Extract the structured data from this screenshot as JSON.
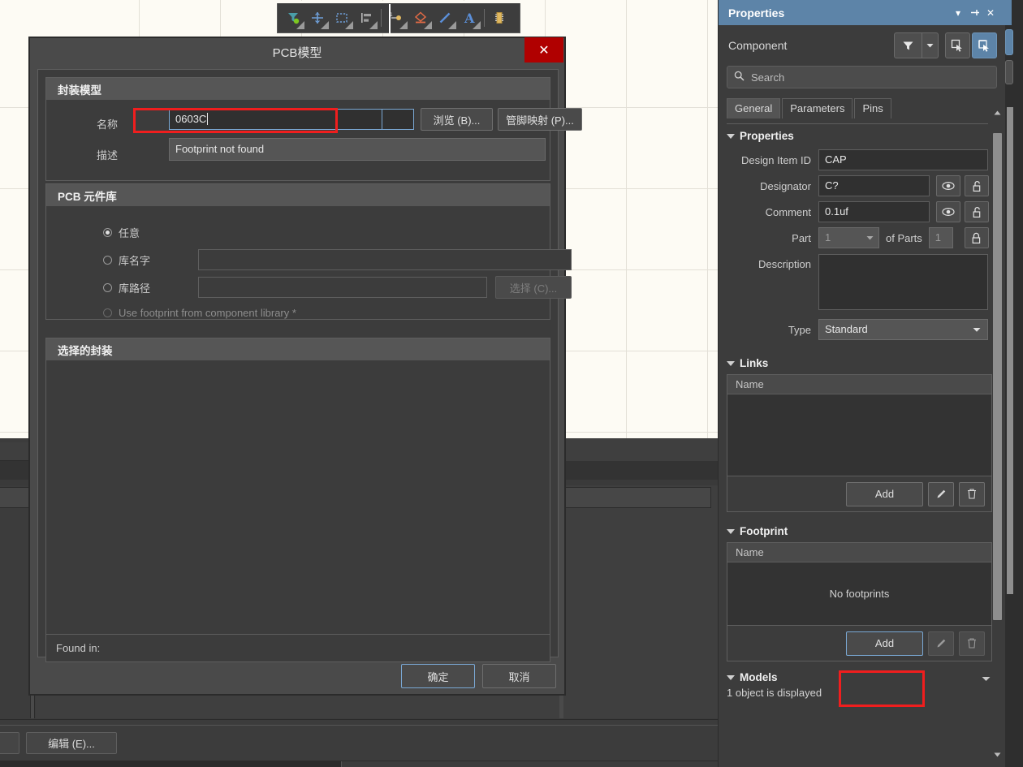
{
  "canvas": {
    "name": "schematic-sheet"
  },
  "toolbar": {
    "name": "schematic-drawing-toolbar",
    "items": [
      {
        "icon": "wiring-tool-icon",
        "label": ""
      },
      {
        "icon": "place-part-crosshair-icon",
        "label": ""
      },
      {
        "icon": "select-rectangle-icon",
        "label": ""
      },
      {
        "icon": "align-objects-icon",
        "label": ""
      },
      {
        "icon": "place-net-label-icon",
        "label": ""
      },
      {
        "icon": "place-polygon-icon",
        "label": ""
      },
      {
        "icon": "place-line-icon",
        "label": ""
      },
      {
        "icon": "place-text-icon",
        "label": ""
      },
      {
        "icon": "place-component-icon",
        "label": ""
      }
    ]
  },
  "dialog": {
    "title": "PCB模型",
    "close_label": "✕",
    "footprint_model": {
      "section_title": "封装模型",
      "name_label": "名称",
      "name_value": "0603C",
      "browse_button": "浏览 (B)...",
      "pin_map_button": "管脚映射 (P)...",
      "description_label": "描述",
      "description_value": "Footprint not found"
    },
    "pcb_library": {
      "section_title": "PCB 元件库",
      "options": [
        {
          "label": "任意",
          "selected": true,
          "disabled": false
        },
        {
          "label": "库名字",
          "selected": false,
          "disabled": false,
          "value": ""
        },
        {
          "label": "库路径",
          "selected": false,
          "disabled": false,
          "value": ""
        },
        {
          "label": "Use footprint from component library *",
          "selected": false,
          "disabled": true
        }
      ],
      "choose_button": "选择 (C)..."
    },
    "selected_footprint": {
      "section_title": "选择的封装",
      "found_in_label": "Found in:"
    },
    "ok_button": "确定",
    "cancel_button": "取消"
  },
  "properties_panel": {
    "title": "Properties",
    "window_controls": {
      "collapse": "▾",
      "pin": "⚲",
      "close": "✕"
    },
    "object_type": "Component",
    "filter_icon": "funnel-filter-icon",
    "filter_dropdown_icon": "chevron-down-icon",
    "search_placeholder": "Search",
    "search_icon": "search-icon",
    "tabs": [
      {
        "label": "General",
        "active": true
      },
      {
        "label": "Parameters",
        "active": false
      },
      {
        "label": "Pins",
        "active": false
      }
    ],
    "properties_section": {
      "title": "Properties",
      "design_item_id_label": "Design Item ID",
      "design_item_id_value": "CAP",
      "designator_label": "Designator",
      "designator_value": "C?",
      "comment_label": "Comment",
      "comment_value": "0.1uf",
      "part_label": "Part",
      "part_value": "1",
      "of_parts_label": "of Parts",
      "of_parts_value": "1",
      "description_label": "Description",
      "description_value": "",
      "type_label": "Type",
      "type_value": "Standard",
      "eye_icon": "eye-visibility-icon",
      "lock_open_icon": "lock-open-icon",
      "lock_closed_icon": "lock-closed-icon"
    },
    "links_section": {
      "title": "Links",
      "column_name": "Name",
      "add_button": "Add",
      "edit_icon": "pencil-edit-icon",
      "delete_icon": "trash-delete-icon"
    },
    "footprint_section": {
      "title": "Footprint",
      "column_name": "Name",
      "empty_text": "No footprints",
      "add_button": "Add",
      "edit_icon": "pencil-edit-icon",
      "delete_icon": "trash-delete-icon"
    },
    "models_section": {
      "title": "Models",
      "status_text": "1 object is displayed",
      "menu_icon": "chevron-down-icon"
    }
  },
  "workspace": {
    "edit_button": "编辑 (E)..."
  },
  "colors": {
    "accent_blue": "#5d84a8",
    "close_red": "#b00000",
    "highlight_red": "#f01e1e",
    "panel_bg": "#3c3c3c",
    "canvas_bg": "#fdfbf4"
  }
}
